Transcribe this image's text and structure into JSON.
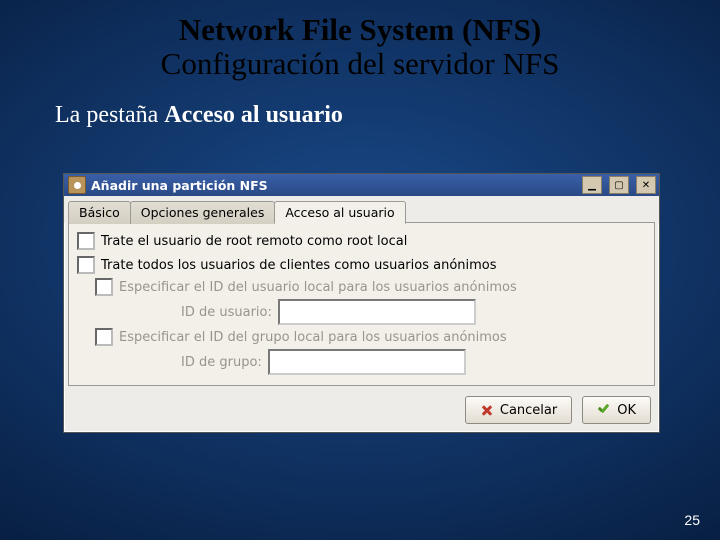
{
  "slide": {
    "title_bold": "Network File System (NFS)",
    "title_sub": "Configuración del servidor NFS",
    "lead_prefix": "La pestaña ",
    "lead_bold": "Acceso al usuario",
    "page_number": "25"
  },
  "dialog": {
    "window_title": "Añadir una partición NFS",
    "tabs": {
      "basic": "Básico",
      "general": "Opciones generales",
      "user_access": "Acceso al usuario"
    },
    "active_tab": "user_access",
    "options": {
      "root_remote_as_local": "Trate el usuario de root remoto como root local",
      "all_clients_anon": "Trate todos los usuarios de clientes como usuarios anónimos",
      "spec_user_id": "Especificar el ID del usuario local para los usuarios anónimos",
      "user_id_label": "ID de usuario:",
      "user_id_value": "",
      "spec_group_id": "Especificar el ID del grupo local para los usuarios anónimos",
      "group_id_label": "ID de grupo:",
      "group_id_value": ""
    },
    "buttons": {
      "cancel": "Cancelar",
      "ok": "OK"
    }
  }
}
